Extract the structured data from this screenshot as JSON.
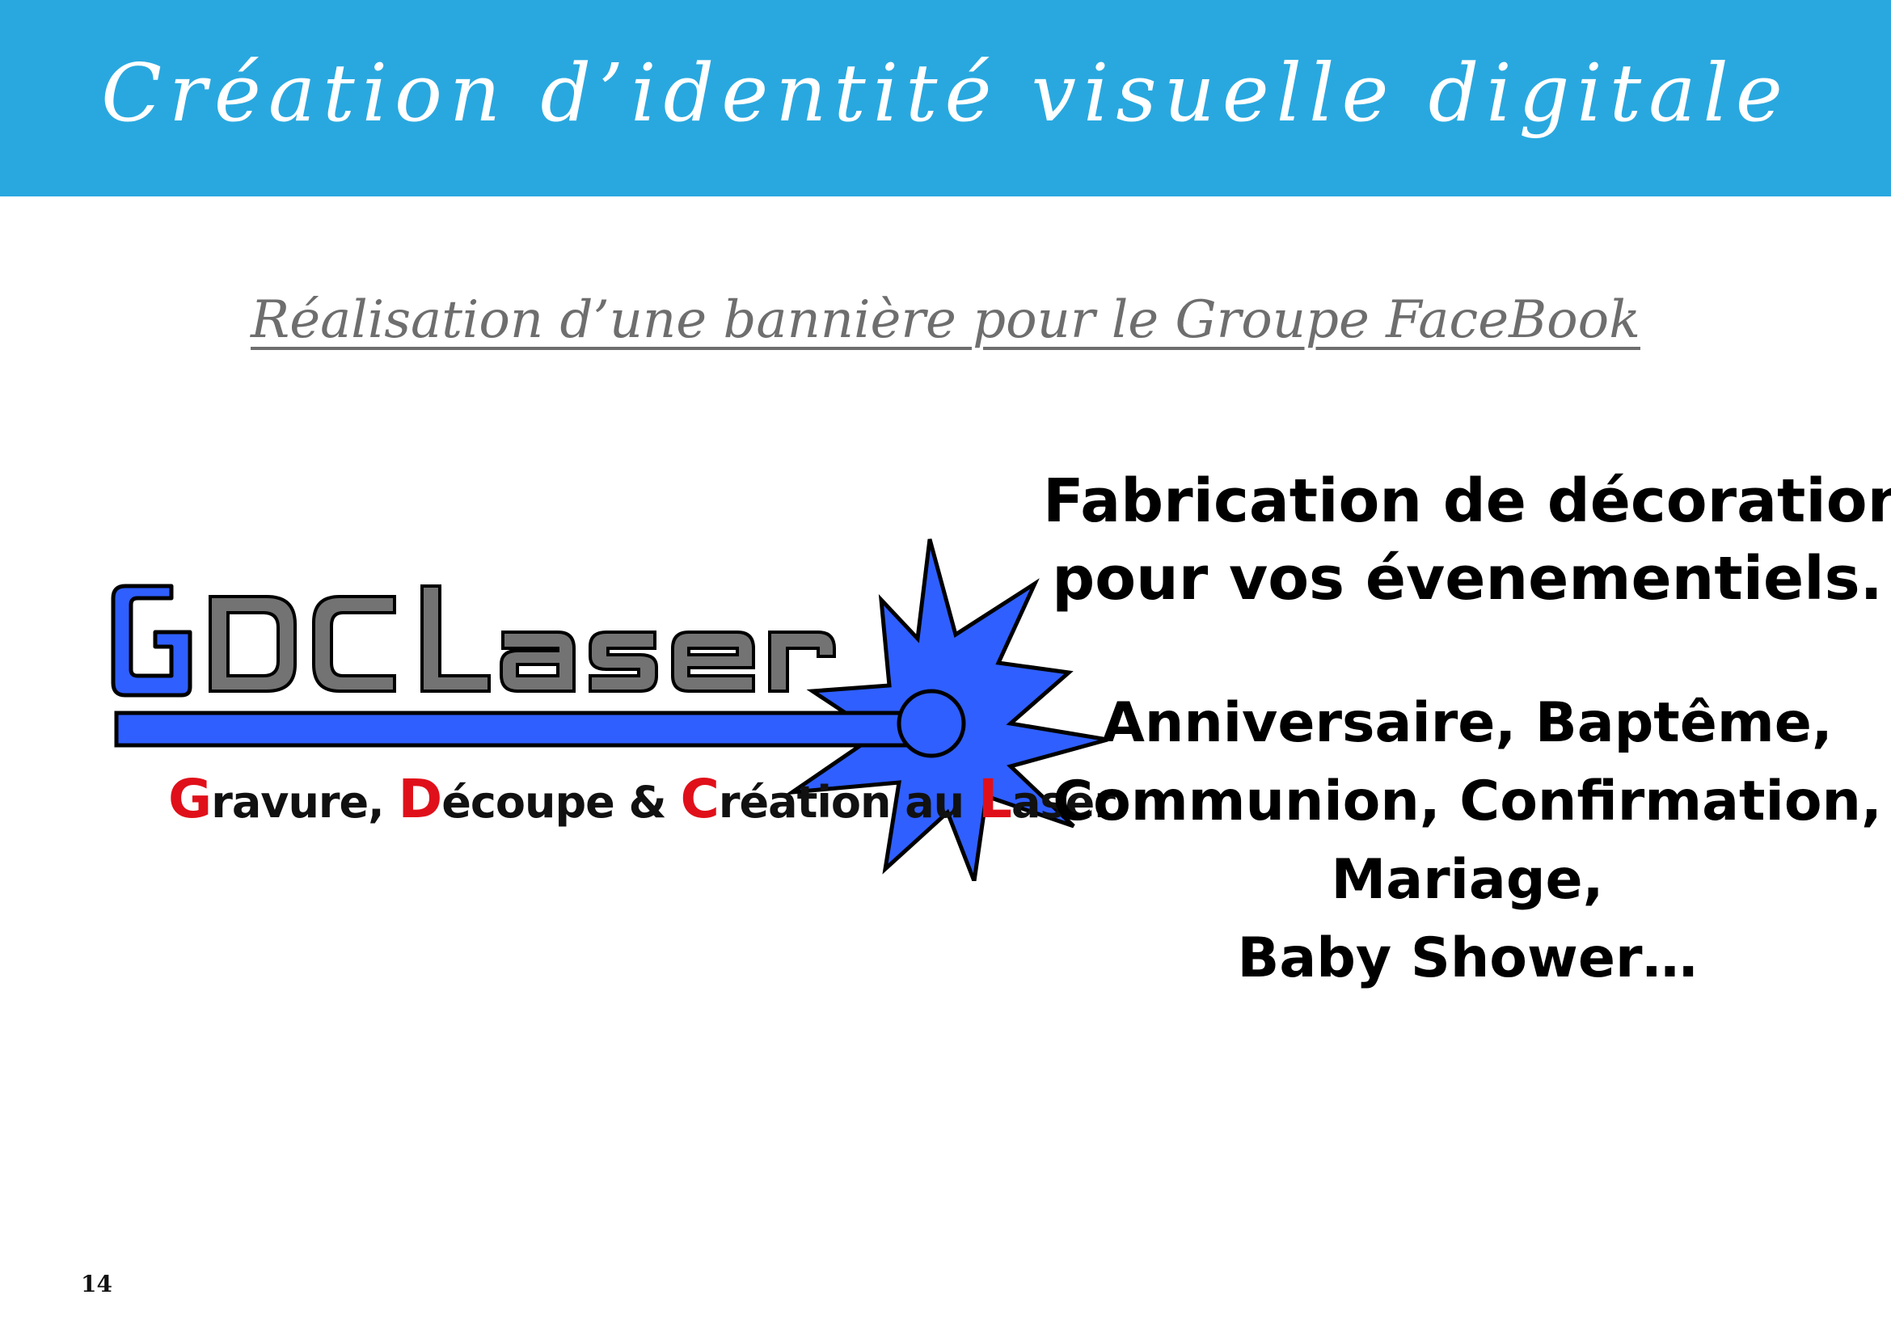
{
  "header": {
    "title": "Création d’identité visuelle digitale",
    "background_color": "#29a8df"
  },
  "subtitle": "Réalisation d’une bannière pour le Groupe FaceBook",
  "logo": {
    "name": "GDC Laser",
    "tagline": {
      "g": "G",
      "g_rest": "ravure, ",
      "d": "D",
      "d_rest": "écoupe & ",
      "c": "C",
      "c_rest": "réation au ",
      "l": "L",
      "l_rest": "aser"
    },
    "colors": {
      "blue": "#2f5fff",
      "gray": "#737373",
      "red": "#e0101a"
    }
  },
  "headline": {
    "line1": "Fabrication de décoration",
    "line2": "pour vos évenementiels."
  },
  "events": {
    "line1": "Anniversaire, Baptême,",
    "line2": "Communion, Confirmation,",
    "line3": "Mariage,",
    "line4": "Baby Shower…"
  },
  "page_number": "14"
}
